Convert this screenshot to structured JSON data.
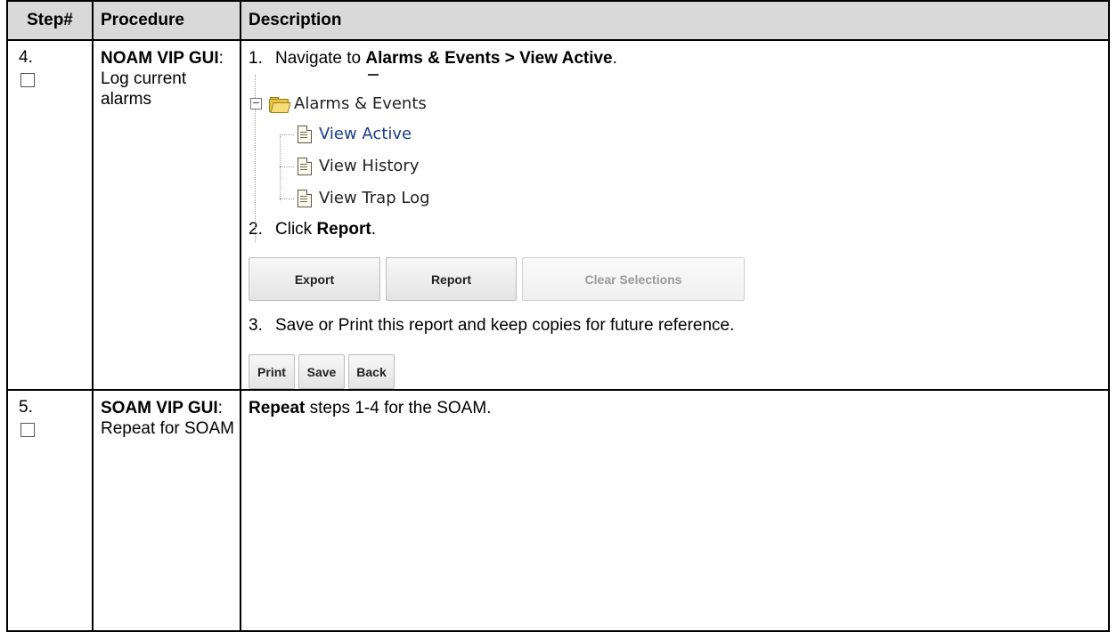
{
  "table": {
    "headers": [
      "Step#",
      "Procedure",
      "Description"
    ],
    "rows": [
      {
        "step": "4.",
        "procedure_bold": "NOAM VIP GUI",
        "procedure_rest": ": Log current alarms"
      },
      {
        "step": "5.",
        "procedure_bold": "SOAM VIP GUI",
        "procedure_rest": ": Repeat for SOAM"
      }
    ]
  },
  "step4": {
    "item1": {
      "num": "1.",
      "text": "Navigate to ",
      "bold": "Alarms & Events > View Active",
      "end": "."
    },
    "tree": {
      "parent": "Alarms & Events",
      "children": [
        "View Active",
        "View History",
        "View Trap Log"
      ],
      "parent_icon": "folder-icon",
      "child_icon": "document-icon",
      "expand_icon": "minus-icon"
    },
    "item2": {
      "num": "2.",
      "text": "Click ",
      "bold": "Report",
      "end": "."
    },
    "buttons1": [
      "Export",
      "Report",
      "Clear Selections"
    ],
    "item3": {
      "num": "3.",
      "text": "Save or Print this report and keep copies for future reference."
    },
    "buttons2": [
      "Print",
      "Save",
      "Back"
    ]
  },
  "step5": {
    "bold": "Repeat",
    "text": " steps 1-4 for the SOAM."
  }
}
